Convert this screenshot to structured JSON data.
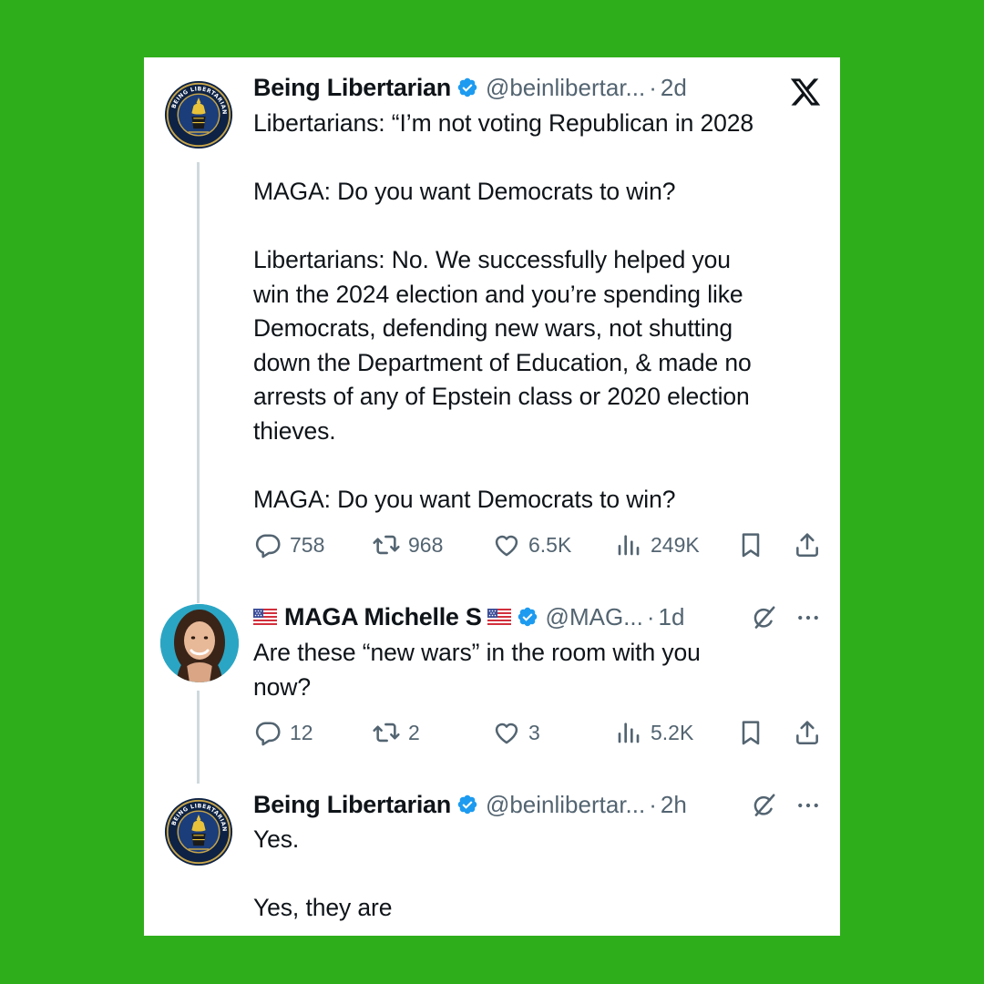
{
  "brand": {
    "icon": "x-logo-icon"
  },
  "tweets": [
    {
      "name": "Being Libertarian",
      "handle": "@beinlibertar...",
      "separator": "·",
      "time": "2d",
      "avatar_icon": "liberty-seal-avatar",
      "avatar_text": "BEING LIBERTARIAN · BECAUSE FREEDOM MATTERS",
      "text": "Libertarians: “I’m not voting Republican in 2028\n\nMAGA: Do you want Democrats to win?\n\nLibertarians: No. We successfully helped you\nwin the 2024 election and you’re spending like\nDemocrats, defending new wars, not shutting\ndown the Department of Education, & made no\narrests of any of Epstein class or 2020 election\nthieves.\n\nMAGA: Do you want Democrats to win?",
      "replies": "758",
      "reposts": "968",
      "likes": "6.5K",
      "views": "249K"
    },
    {
      "name": "MAGA Michelle S",
      "handle": "@MAG...",
      "separator": "·",
      "time": "1d",
      "flag_icon": "us-flag-icon",
      "text": "Are these “new wars” in the room with you\nnow?",
      "replies": "12",
      "reposts": "2",
      "likes": "3",
      "views": "5.2K"
    },
    {
      "name": "Being Libertarian",
      "handle": "@beinlibertar...",
      "separator": "·",
      "time": "2h",
      "text": "Yes.\n\nYes, they are"
    }
  ],
  "colors": {
    "background": "#2fae1b",
    "card": "#ffffff",
    "verified": "#1d9bf0",
    "muted": "#536471",
    "text": "#0f1419"
  }
}
